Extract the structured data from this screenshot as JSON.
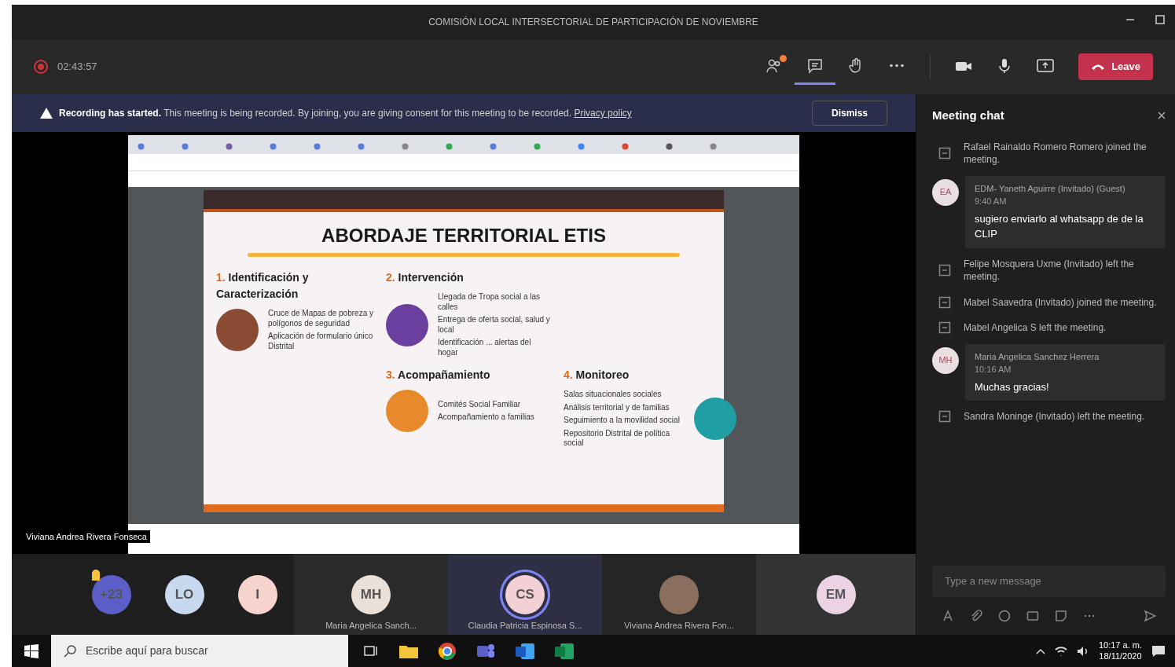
{
  "window": {
    "title": "COMISIÓN LOCAL INTERSECTORIAL DE PARTICIPACIÓN DE NOVIEMBRE"
  },
  "meeting_bar": {
    "timer": "02:43:57",
    "tools": [
      {
        "kind": "people",
        "selected": false,
        "badge": true
      },
      {
        "kind": "chat",
        "selected": true,
        "badge": false
      },
      {
        "kind": "hand",
        "selected": false,
        "badge": false
      },
      {
        "kind": "more",
        "selected": false,
        "badge": false
      },
      {
        "kind": "camera",
        "selected": false,
        "badge": false
      },
      {
        "kind": "mic",
        "selected": false,
        "badge": false
      },
      {
        "kind": "share",
        "selected": false,
        "badge": false
      }
    ],
    "leave": "Leave"
  },
  "banner": {
    "title": "Recording has started.",
    "text": "This meeting is being recorded. By joining, you are giving consent for this meeting to be recorded.",
    "link": "Privacy policy",
    "button": "Dismiss"
  },
  "slide": {
    "title": "ABORDAJE TERRITORIAL ETIS",
    "sections": [
      {
        "number": "1.",
        "heading": "Identificación y Caracterización",
        "items": [
          "Cruce de Mapas de pobreza y polígonos de seguridad",
          "Aplicación de formulario único Distrital"
        ]
      },
      {
        "number": "2.",
        "heading": "Intervención",
        "items": [
          "Llegada de Tropa social a las calles",
          "Entrega de oferta social, salud y local",
          "Identificación ... alertas del hogar"
        ]
      },
      {
        "number": "3.",
        "heading": "Acompañamiento",
        "items": [
          "Comités Social Familiar",
          "Acompañamiento a familias"
        ]
      },
      {
        "number": "4.",
        "heading": "Monitoreo",
        "items": [
          "Salas situacionales sociales",
          "Análisis territorial y de familias",
          "Seguimiento a la movilidad social",
          "Repositorio Distrital de política social"
        ]
      }
    ]
  },
  "presenter": "Viviana Andrea Rivera Fonseca",
  "chat": {
    "title": "Meeting chat",
    "entries": [
      {
        "kind": "event",
        "text": "Rafael Rainaldo Romero Romero joined the meeting."
      },
      {
        "kind": "message",
        "initials": "EA",
        "author": "EDM- Yaneth Aguirre (Invitado) (Guest)",
        "time": "9:40 AM",
        "text": "sugiero enviarlo al whatsapp de de la CLIP"
      },
      {
        "kind": "event",
        "text": "Felipe Mosquera Uxme (Invitado) left the meeting."
      },
      {
        "kind": "event",
        "text": "Mabel Saavedra (Invitado) joined the meeting."
      },
      {
        "kind": "event",
        "text": "Mabel Angelica S left the meeting."
      },
      {
        "kind": "message",
        "initials": "MH",
        "author": "Maria Angelica Sanchez Herrera",
        "time": "10:16 AM",
        "text": "Muchas gracias!"
      },
      {
        "kind": "event",
        "text": "Sandra Moninge (Invitado) left the meeting."
      }
    ],
    "input": {
      "placeholder": "Type a new message"
    }
  },
  "participants": [
    {
      "kind": "avatar",
      "initials": "+23",
      "color": "#5b5fc7",
      "speaking": false,
      "hand_raised": true
    },
    {
      "kind": "avatar",
      "initials": "LO",
      "color": "#c7d9ef",
      "speaking": false,
      "hand_raised": false
    },
    {
      "kind": "avatar",
      "initials": "I",
      "color": "#f6d3cc",
      "speaking": false,
      "hand_raised": false
    },
    {
      "kind": "avatar",
      "initials": "MH",
      "color": "#eae0d8",
      "name": "Maria Angelica Sanch...",
      "speaking": false,
      "hand_raised": false
    },
    {
      "kind": "avatar",
      "initials": "CS",
      "color": "#f3d0d6",
      "name": "Claudia Patricia Espinosa S...",
      "speaking": true,
      "hand_raised": false
    },
    {
      "kind": "photo",
      "name": "Viviana Andrea Rivera Fon...",
      "speaking": false,
      "hand_raised": false
    },
    {
      "kind": "avatar",
      "initials": "EM",
      "color": "#ecd3e4",
      "speaking": false,
      "hand_raised": false
    }
  ],
  "taskbar": {
    "search_placeholder": "Escribe aquí para buscar",
    "time": "10:17 a. m.",
    "date": "18/11/2020"
  }
}
